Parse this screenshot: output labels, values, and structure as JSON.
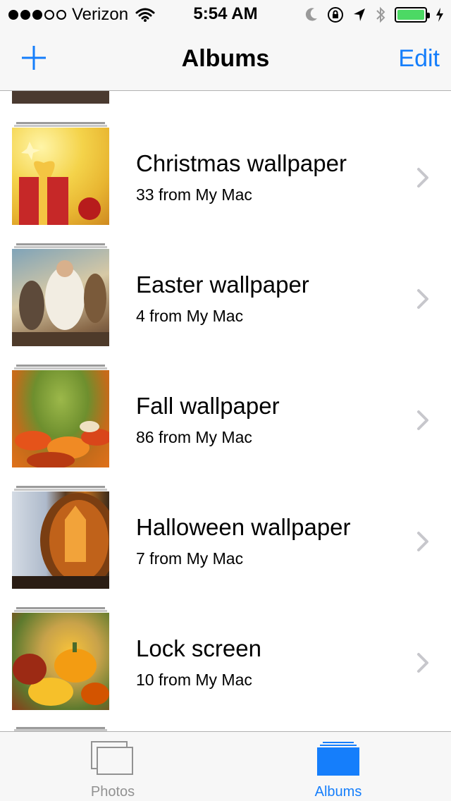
{
  "status_bar": {
    "signal_dots": [
      true,
      true,
      true,
      false,
      false
    ],
    "carrier": "Verizon",
    "time": "5:54 AM",
    "battery_color": "#4cd964"
  },
  "nav": {
    "title": "Albums",
    "add_icon": "plus-icon",
    "edit_label": "Edit",
    "accent_color": "#157efb"
  },
  "albums": [
    {
      "title": "Christmas wallpaper",
      "subtitle": "33 from My Mac",
      "thumb": "t-christmas"
    },
    {
      "title": "Easter wallpaper",
      "subtitle": "4 from My Mac",
      "thumb": "t-easter"
    },
    {
      "title": "Fall wallpaper",
      "subtitle": "86 from My Mac",
      "thumb": "t-fall"
    },
    {
      "title": "Halloween wallpaper",
      "subtitle": "7 from My Mac",
      "thumb": "t-halloween"
    },
    {
      "title": "Lock screen",
      "subtitle": "10 from My Mac",
      "thumb": "t-lock"
    }
  ],
  "tab_bar": {
    "tabs": [
      {
        "label": "Photos",
        "icon": "photos-icon",
        "selected": false
      },
      {
        "label": "Albums",
        "icon": "albums-icon",
        "selected": true
      }
    ]
  }
}
